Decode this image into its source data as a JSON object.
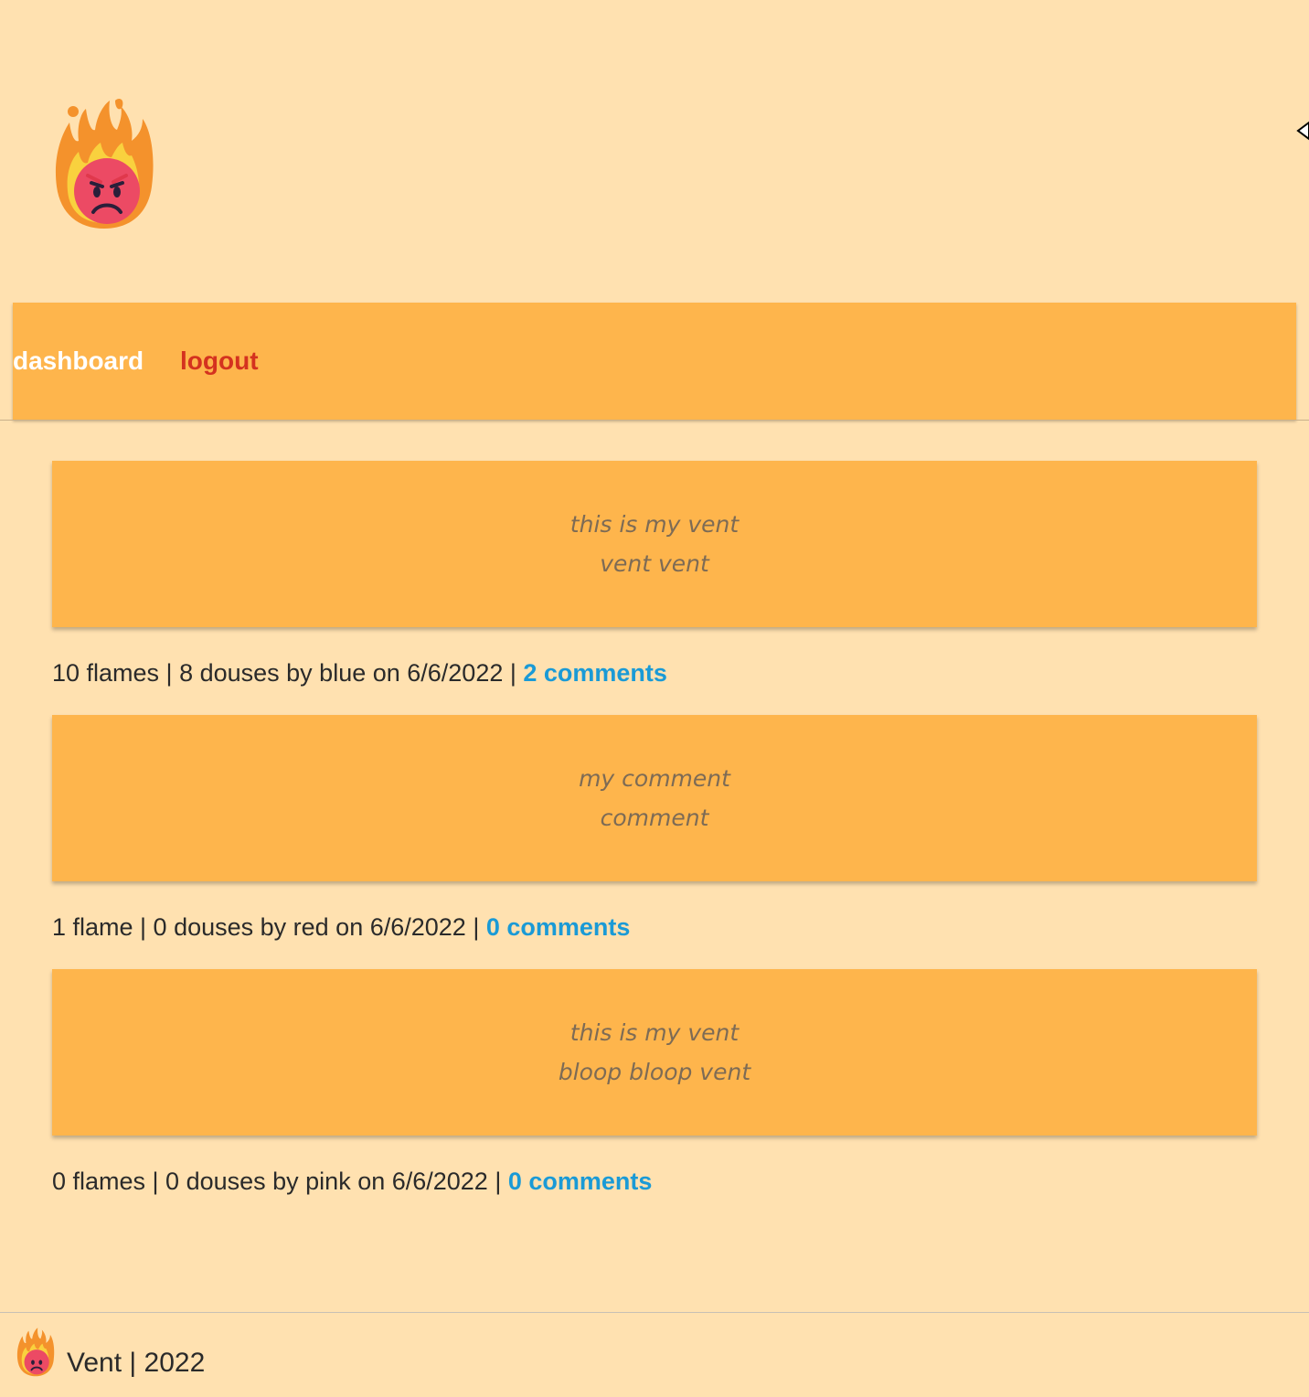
{
  "header": {
    "logo_icon": "angry-face-on-fire-icon"
  },
  "nav": {
    "dashboard_label": "dashboard",
    "logout_label": "logout"
  },
  "posts": [
    {
      "title": "this is my vent",
      "body": "vent vent",
      "meta": "10 flames | 8 douses by blue on 6/6/2022 | ",
      "comments_label": "2 comments"
    },
    {
      "title": "my comment",
      "body": "comment",
      "meta": "1 flame | 0 douses by red on 6/6/2022 | ",
      "comments_label": "0 comments"
    },
    {
      "title": "this is my vent",
      "body": "bloop bloop vent",
      "meta": "0 flames | 0 douses by pink on 6/6/2022 | ",
      "comments_label": "0 comments"
    }
  ],
  "footer": {
    "text": "Vent | 2022",
    "logo_icon": "angry-face-on-fire-icon"
  },
  "colors": {
    "page_bg": "#ffe1b0",
    "card_bg": "#feb54c",
    "link_blue": "#1a9ad6",
    "logout_red": "#d4321f"
  }
}
